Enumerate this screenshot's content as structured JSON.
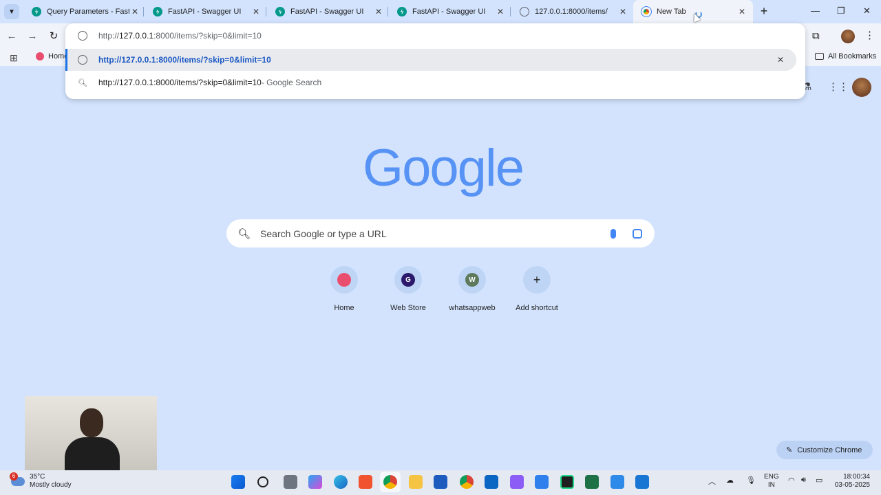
{
  "tabs": [
    {
      "title": "Query Parameters - FastAPI",
      "favicon": "fastapi-icon"
    },
    {
      "title": "FastAPI - Swagger UI",
      "favicon": "fastapi-icon"
    },
    {
      "title": "FastAPI - Swagger UI",
      "favicon": "fastapi-icon"
    },
    {
      "title": "FastAPI - Swagger UI",
      "favicon": "fastapi-icon"
    },
    {
      "title": "127.0.0.1:8000/items/",
      "favicon": "globe-icon"
    },
    {
      "title": "New Tab",
      "favicon": "chrome-icon"
    }
  ],
  "omnibox": {
    "host": "127.0.0.1",
    "prefix": "http://",
    "rest": ":8000/items/?skip=0&limit=10",
    "suggestions": [
      {
        "text": "http://127.0.0.1:8000/items/?skip=0&limit=10",
        "type": "url"
      },
      {
        "text": "http://127.0.0.1:8000/items/?skip=0&limit=10",
        "suffix": " - Google Search",
        "type": "search"
      }
    ]
  },
  "bookmarks": {
    "home": "Home",
    "all": "All Bookmarks"
  },
  "page": {
    "logo": "Google",
    "search_placeholder": "Search Google or type a URL",
    "shortcuts": [
      {
        "label": "Home",
        "letter": "",
        "color": "#e94e6f"
      },
      {
        "label": "Web Store",
        "letter": "G",
        "color": "#2b1a6b"
      },
      {
        "label": "whatsappweb",
        "letter": "W",
        "color": "#5d7a5d"
      },
      {
        "label": "Add shortcut",
        "letter": "+",
        "color": ""
      }
    ],
    "customize": "Customize Chrome"
  },
  "taskbar": {
    "weather_badge": "6",
    "temperature": "35°C",
    "condition": "Mostly cloudy",
    "lang_1": "ENG",
    "lang_2": "IN",
    "time": "18:00:34",
    "date": "03-05-2025"
  },
  "colors": {
    "accent": "#1a73e8",
    "background": "#d3e3fd"
  }
}
